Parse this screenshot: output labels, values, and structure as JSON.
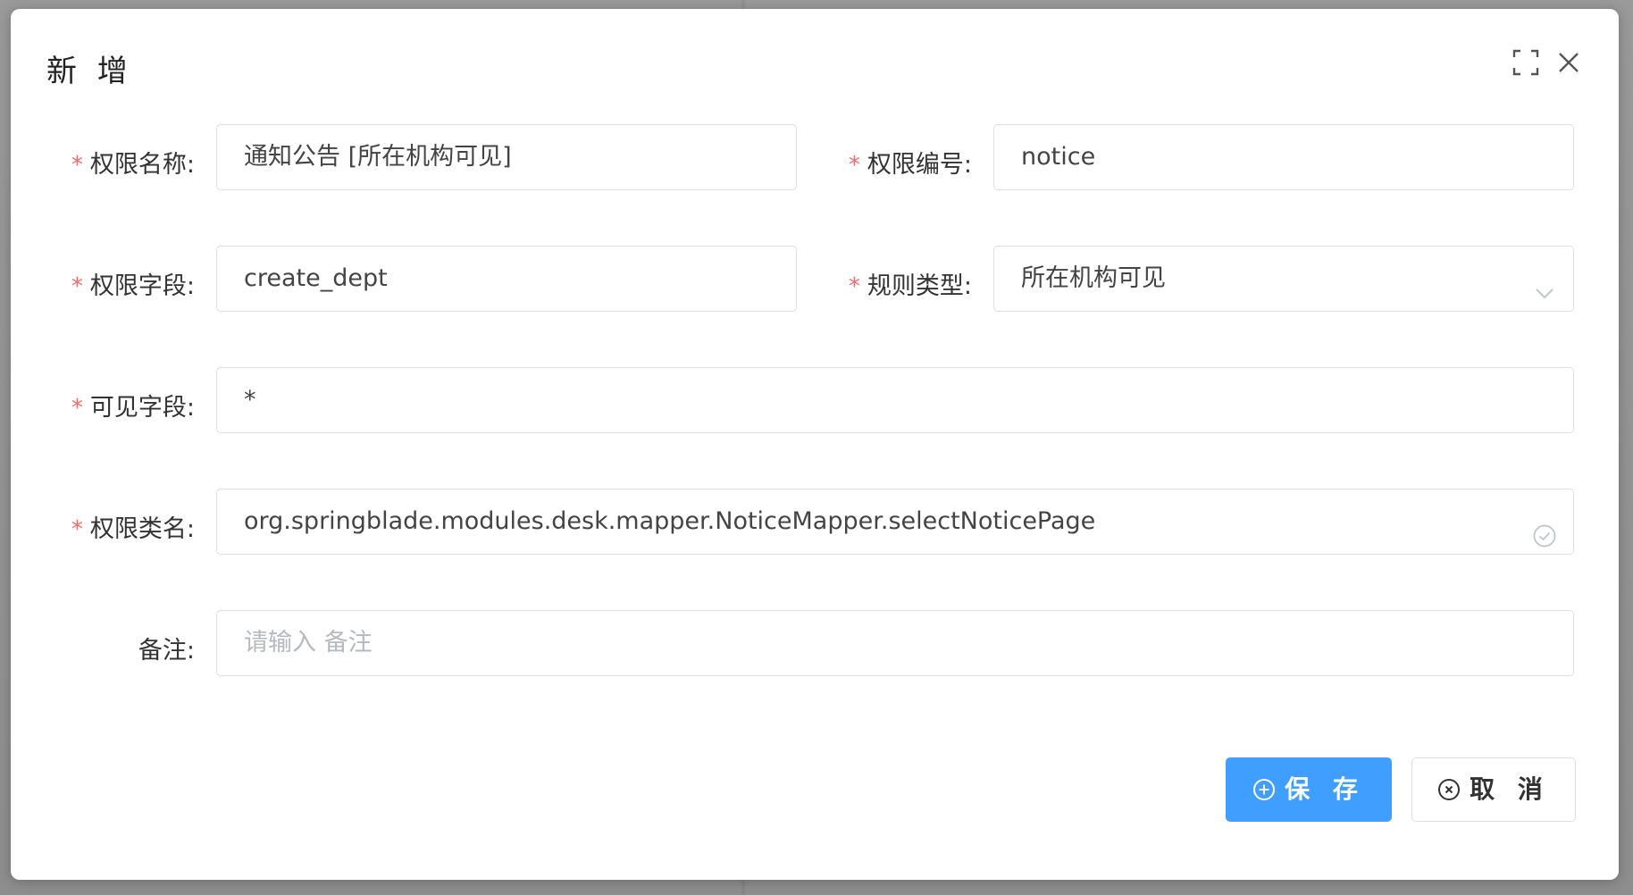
{
  "dialog": {
    "title": "新 增"
  },
  "form": {
    "scope_name": {
      "label": "权限名称:",
      "required_mark": "*",
      "value": "通知公告 [所在机构可见]"
    },
    "scope_code": {
      "label": "权限编号:",
      "required_mark": "*",
      "value": "notice"
    },
    "scope_column": {
      "label": "权限字段:",
      "required_mark": "*",
      "value": "create_dept"
    },
    "rule_type": {
      "label": "规则类型:",
      "required_mark": "*",
      "value": "所在机构可见"
    },
    "scope_field": {
      "label": "可见字段:",
      "required_mark": "*",
      "value": "*"
    },
    "scope_class": {
      "label": "权限类名:",
      "required_mark": "*",
      "value": "org.springblade.modules.desk.mapper.NoticeMapper.selectNoticePage"
    },
    "remark": {
      "label": "备注:",
      "value": "",
      "placeholder": "请输入 备注"
    }
  },
  "buttons": {
    "save_label": "保 存",
    "cancel_label": "取 消"
  },
  "icons": {
    "fullscreen": "fullscreen-icon",
    "close": "close-icon",
    "dropdown": "chevron-down-icon",
    "valid": "circle-check-icon",
    "save": "circle-plus-icon",
    "cancel": "circle-close-icon"
  },
  "colors": {
    "primary": "#409eff",
    "required": "#f56c6c",
    "border": "#dcdfe6",
    "placeholder": "#b6b9c0"
  }
}
